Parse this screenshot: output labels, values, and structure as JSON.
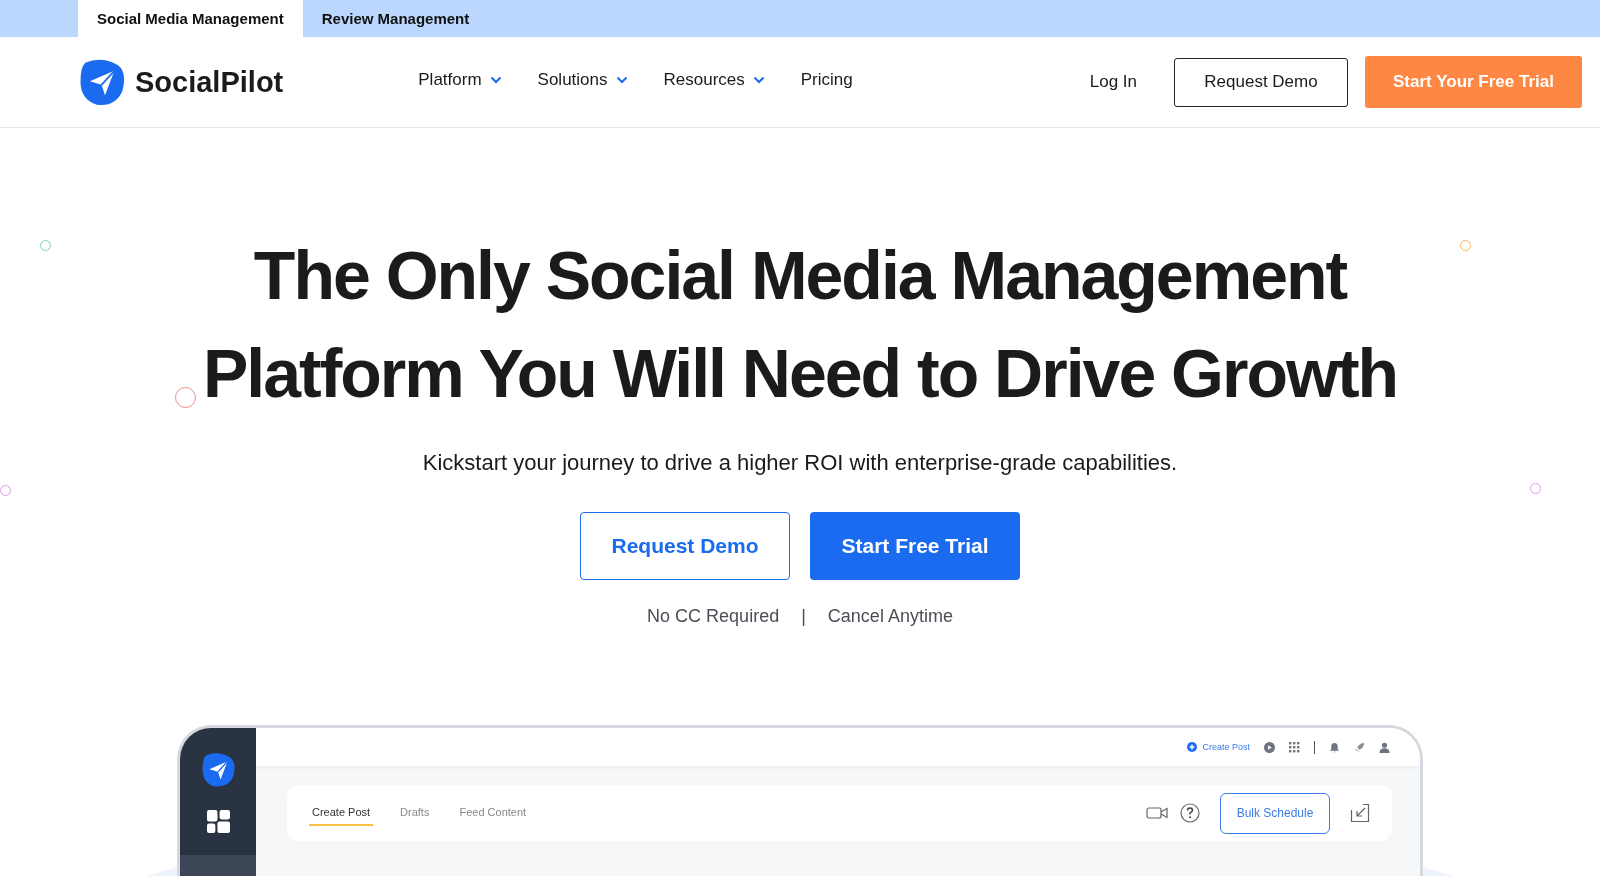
{
  "top_tabs": [
    {
      "label": "Social Media Management",
      "selected": true
    },
    {
      "label": "Review Management",
      "selected": false
    }
  ],
  "header": {
    "brand": "SocialPilot",
    "nav": [
      {
        "label": "Platform",
        "dropdown": true
      },
      {
        "label": "Solutions",
        "dropdown": true
      },
      {
        "label": "Resources",
        "dropdown": true
      },
      {
        "label": "Pricing",
        "dropdown": false
      }
    ],
    "login": "Log In",
    "demo_button": "Request Demo",
    "trial_button": "Start Your Free Trial"
  },
  "hero": {
    "title_lines": [
      "The Only Social Media Management",
      "Platform You Will Need to Drive Growth"
    ],
    "subtitle": "Kickstart your journey to drive a higher ROI with enterprise-grade capabilities.",
    "buttons": [
      {
        "label": "Request Demo",
        "kind": "outline"
      },
      {
        "label": "Start Free Trial",
        "kind": "primary"
      }
    ],
    "notes": [
      "No CC Required",
      "Cancel Anytime"
    ],
    "note_separator": "|"
  },
  "app_preview": {
    "topbar_link": "Create Post",
    "tabs": [
      {
        "label": "Create Post",
        "selected": true
      },
      {
        "label": "Drafts",
        "selected": false
      },
      {
        "label": "Feed Content",
        "selected": false
      }
    ],
    "bulk_button": "Bulk Schedule"
  }
}
